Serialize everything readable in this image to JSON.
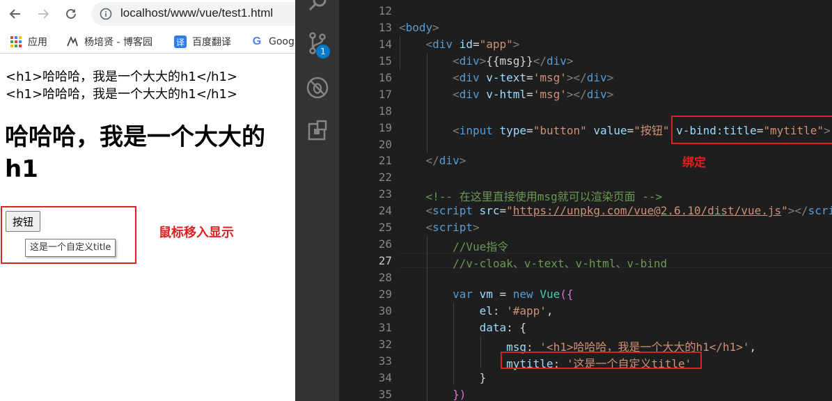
{
  "browser": {
    "url": "localhost/www/vue/test1.html",
    "bookmarks": [
      {
        "label": "应用",
        "icon": "apps-grid-icon"
      },
      {
        "label": "杨培贤 - 博客园",
        "icon": "cnblogs-icon"
      },
      {
        "label": "百度翻译",
        "icon": "baidu-translate-icon"
      },
      {
        "label": "Goog",
        "icon": "google-icon"
      }
    ],
    "page": {
      "raw_line_1": "<h1>哈哈哈，我是一个大大的h1</h1>",
      "raw_line_2": "<h1>哈哈哈，我是一个大大的h1</h1>",
      "heading": "哈哈哈，我是一个大大的h1",
      "button_label": "按钮",
      "tooltip": "这是一个自定义title",
      "annotation": "鼠标移入显示"
    }
  },
  "vscode": {
    "scm_badge": "1",
    "active_line": 27,
    "annotation": "绑定",
    "lines": [
      {
        "n": 12,
        "tokens": []
      },
      {
        "n": 13,
        "tokens": [
          [
            "t-punct",
            "<"
          ],
          [
            "t-tag",
            "body"
          ],
          [
            "t-punct",
            ">"
          ]
        ]
      },
      {
        "n": 14,
        "tokens": [
          [
            "t-plain",
            "    "
          ],
          [
            "t-punct",
            "<"
          ],
          [
            "t-tag",
            "div"
          ],
          [
            "t-plain",
            " "
          ],
          [
            "t-attr",
            "id"
          ],
          [
            "t-plain",
            "="
          ],
          [
            "t-str",
            "\"app\""
          ],
          [
            "t-punct",
            ">"
          ]
        ]
      },
      {
        "n": 15,
        "tokens": [
          [
            "t-plain",
            "        "
          ],
          [
            "t-punct",
            "<"
          ],
          [
            "t-tag",
            "div"
          ],
          [
            "t-punct",
            ">"
          ],
          [
            "t-plain",
            "{{msg}}"
          ],
          [
            "t-punct",
            "</"
          ],
          [
            "t-tag",
            "div"
          ],
          [
            "t-punct",
            ">"
          ]
        ]
      },
      {
        "n": 16,
        "tokens": [
          [
            "t-plain",
            "        "
          ],
          [
            "t-punct",
            "<"
          ],
          [
            "t-tag",
            "div"
          ],
          [
            "t-plain",
            " "
          ],
          [
            "t-attr",
            "v-text"
          ],
          [
            "t-plain",
            "="
          ],
          [
            "t-str",
            "'msg'"
          ],
          [
            "t-punct",
            "></"
          ],
          [
            "t-tag",
            "div"
          ],
          [
            "t-punct",
            ">"
          ]
        ]
      },
      {
        "n": 17,
        "tokens": [
          [
            "t-plain",
            "        "
          ],
          [
            "t-punct",
            "<"
          ],
          [
            "t-tag",
            "div"
          ],
          [
            "t-plain",
            " "
          ],
          [
            "t-attr",
            "v-html"
          ],
          [
            "t-plain",
            "="
          ],
          [
            "t-str",
            "'msg'"
          ],
          [
            "t-punct",
            "></"
          ],
          [
            "t-tag",
            "div"
          ],
          [
            "t-punct",
            ">"
          ]
        ]
      },
      {
        "n": 18,
        "tokens": []
      },
      {
        "n": 19,
        "tokens": [
          [
            "t-plain",
            "        "
          ],
          [
            "t-punct",
            "<"
          ],
          [
            "t-tag",
            "input"
          ],
          [
            "t-plain",
            " "
          ],
          [
            "t-attr",
            "type"
          ],
          [
            "t-plain",
            "="
          ],
          [
            "t-str",
            "\"button\""
          ],
          [
            "t-plain",
            " "
          ],
          [
            "t-attr",
            "value"
          ],
          [
            "t-plain",
            "="
          ],
          [
            "t-str",
            "\"按钮\""
          ],
          [
            "t-plain",
            " "
          ],
          [
            "t-attr",
            "v-bind:title"
          ],
          [
            "t-plain",
            "="
          ],
          [
            "t-str",
            "\"mytitle\""
          ],
          [
            "t-punct",
            ">"
          ]
        ]
      },
      {
        "n": 20,
        "tokens": []
      },
      {
        "n": 21,
        "tokens": [
          [
            "t-plain",
            "    "
          ],
          [
            "t-punct",
            "</"
          ],
          [
            "t-tag",
            "div"
          ],
          [
            "t-punct",
            ">"
          ]
        ]
      },
      {
        "n": 22,
        "tokens": []
      },
      {
        "n": 23,
        "tokens": [
          [
            "t-plain",
            "    "
          ],
          [
            "t-cmt",
            "<!-- 在这里直接使用msg就可以渲染页面 -->"
          ]
        ]
      },
      {
        "n": 24,
        "tokens": [
          [
            "t-plain",
            "    "
          ],
          [
            "t-punct",
            "<"
          ],
          [
            "t-tag",
            "script"
          ],
          [
            "t-plain",
            " "
          ],
          [
            "t-attr",
            "src"
          ],
          [
            "t-plain",
            "="
          ],
          [
            "t-str",
            "\""
          ],
          [
            "t-url",
            "https://unpkg.com/vue@2.6.10/dist/vue.js"
          ],
          [
            "t-str",
            "\""
          ],
          [
            "t-punct",
            "></"
          ],
          [
            "t-tag",
            "scri"
          ]
        ]
      },
      {
        "n": 25,
        "tokens": [
          [
            "t-plain",
            "    "
          ],
          [
            "t-punct",
            "<"
          ],
          [
            "t-tag",
            "script"
          ],
          [
            "t-punct",
            ">"
          ]
        ]
      },
      {
        "n": 26,
        "tokens": [
          [
            "t-plain",
            "        "
          ],
          [
            "t-cmt",
            "//Vue指令"
          ]
        ]
      },
      {
        "n": 27,
        "tokens": [
          [
            "t-plain",
            "        "
          ],
          [
            "t-cmt",
            "//v-cloak、v-text、v-html、v-bind"
          ]
        ]
      },
      {
        "n": 28,
        "tokens": []
      },
      {
        "n": 29,
        "tokens": [
          [
            "t-plain",
            "        "
          ],
          [
            "t-kw",
            "var"
          ],
          [
            "t-plain",
            " "
          ],
          [
            "t-var",
            "vm"
          ],
          [
            "t-plain",
            " = "
          ],
          [
            "t-kw",
            "new"
          ],
          [
            "t-plain",
            " "
          ],
          [
            "t-cls",
            "Vue"
          ],
          [
            "t-brace",
            "({"
          ]
        ]
      },
      {
        "n": 30,
        "tokens": [
          [
            "t-plain",
            "            "
          ],
          [
            "t-var",
            "el"
          ],
          [
            "t-plain",
            ": "
          ],
          [
            "t-str",
            "'#app'"
          ],
          [
            "t-plain",
            ","
          ]
        ]
      },
      {
        "n": 31,
        "tokens": [
          [
            "t-plain",
            "            "
          ],
          [
            "t-var",
            "data"
          ],
          [
            "t-plain",
            ": {"
          ]
        ]
      },
      {
        "n": 32,
        "tokens": [
          [
            "t-plain",
            "                "
          ],
          [
            "t-var",
            "msg"
          ],
          [
            "t-plain",
            ": "
          ],
          [
            "t-str",
            "'<h1>哈哈哈，我是一个大大的h1</h1>'"
          ],
          [
            "t-plain",
            ","
          ]
        ]
      },
      {
        "n": 33,
        "tokens": [
          [
            "t-plain",
            "                "
          ],
          [
            "t-var",
            "mytitle"
          ],
          [
            "t-plain",
            ": "
          ],
          [
            "t-str",
            "'这是一个自定义title'"
          ]
        ]
      },
      {
        "n": 34,
        "tokens": [
          [
            "t-plain",
            "            }"
          ]
        ]
      },
      {
        "n": 35,
        "tokens": [
          [
            "t-plain",
            "        "
          ],
          [
            "t-brace",
            "})"
          ]
        ]
      }
    ]
  }
}
